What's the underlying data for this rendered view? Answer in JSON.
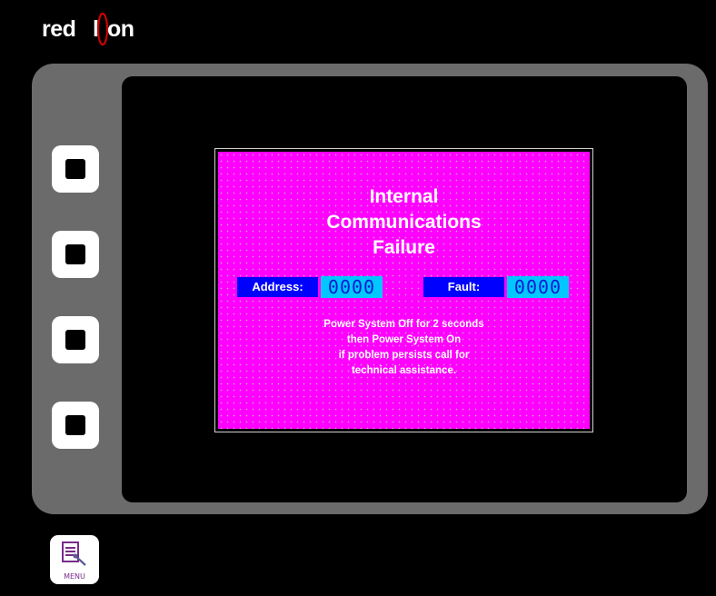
{
  "brand": {
    "word1": "red",
    "word2_part1": "l",
    "word2_part2": "on"
  },
  "softkeys": [
    {
      "id": "f1"
    },
    {
      "id": "f2"
    },
    {
      "id": "f3"
    },
    {
      "id": "f4"
    }
  ],
  "alarm": {
    "title_lines": [
      "Internal",
      "Communications",
      "Failure"
    ],
    "address_label": "Address:",
    "address_value": "0000",
    "fault_label": "Fault:",
    "fault_value": "0000",
    "message_lines": [
      "Power System Off for 2 seconds",
      "then Power System On",
      "if problem persists call for",
      "technical assistance."
    ],
    "colors": {
      "background": "#ff00ff",
      "label_bg": "#0000ff",
      "value_bg": "#00c8ff"
    }
  },
  "menu_button": {
    "label": "MENU",
    "icon": "menu-document-icon"
  }
}
